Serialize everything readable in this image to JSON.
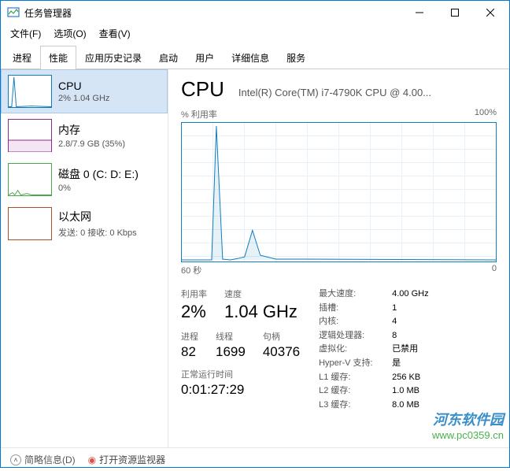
{
  "window": {
    "title": "任务管理器"
  },
  "menu": {
    "file": "文件(F)",
    "options": "选项(O)",
    "view": "查看(V)"
  },
  "tabs": {
    "processes": "进程",
    "performance": "性能",
    "app_history": "应用历史记录",
    "startup": "启动",
    "users": "用户",
    "details": "详细信息",
    "services": "服务"
  },
  "sidebar": {
    "cpu": {
      "name": "CPU",
      "val": "2% 1.04 GHz"
    },
    "mem": {
      "name": "内存",
      "val": "2.8/7.9 GB (35%)"
    },
    "disk": {
      "name": "磁盘 0 (C: D: E:)",
      "val": "0%"
    },
    "eth": {
      "name": "以太网",
      "val": "发送: 0 接收: 0 Kbps"
    }
  },
  "detail": {
    "title": "CPU",
    "subtitle": "Intel(R) Core(TM) i7-4790K CPU @ 4.00...",
    "chart_label": "% 利用率",
    "chart_max": "100%",
    "chart_x_left": "60 秒",
    "chart_x_right": "0",
    "util_label": "利用率",
    "util": "2%",
    "speed_label": "速度",
    "speed": "1.04 GHz",
    "proc_label": "进程",
    "proc": "82",
    "thread_label": "线程",
    "thread": "1699",
    "handle_label": "句柄",
    "handle": "40376",
    "uptime_label": "正常运行时间",
    "uptime": "0:01:27:29",
    "kv": {
      "max_speed_k": "最大速度:",
      "max_speed_v": "4.00 GHz",
      "sockets_k": "插槽:",
      "sockets_v": "1",
      "cores_k": "内核:",
      "cores_v": "4",
      "logical_k": "逻辑处理器:",
      "logical_v": "8",
      "virt_k": "虚拟化:",
      "virt_v": "已禁用",
      "hyperv_k": "Hyper-V 支持:",
      "hyperv_v": "是",
      "l1_k": "L1 缓存:",
      "l1_v": "256 KB",
      "l2_k": "L2 缓存:",
      "l2_v": "1.0 MB",
      "l3_k": "L3 缓存:",
      "l3_v": "8.0 MB"
    }
  },
  "status": {
    "fewer": "简略信息(D)",
    "resmon": "打开资源监视器"
  },
  "watermark": {
    "line1": "河东软件园",
    "line2": "www.pc0359.cn"
  },
  "chart_data": {
    "type": "line",
    "title": "% 利用率",
    "ylim": [
      0,
      100
    ],
    "xrange_seconds": [
      60,
      0
    ],
    "x": [
      0,
      2,
      4,
      6,
      8,
      10,
      12,
      14,
      16,
      18,
      20,
      22,
      24,
      60
    ],
    "values": [
      2,
      2,
      2,
      100,
      2,
      1,
      2,
      3,
      22,
      4,
      2,
      2,
      2,
      2
    ]
  }
}
